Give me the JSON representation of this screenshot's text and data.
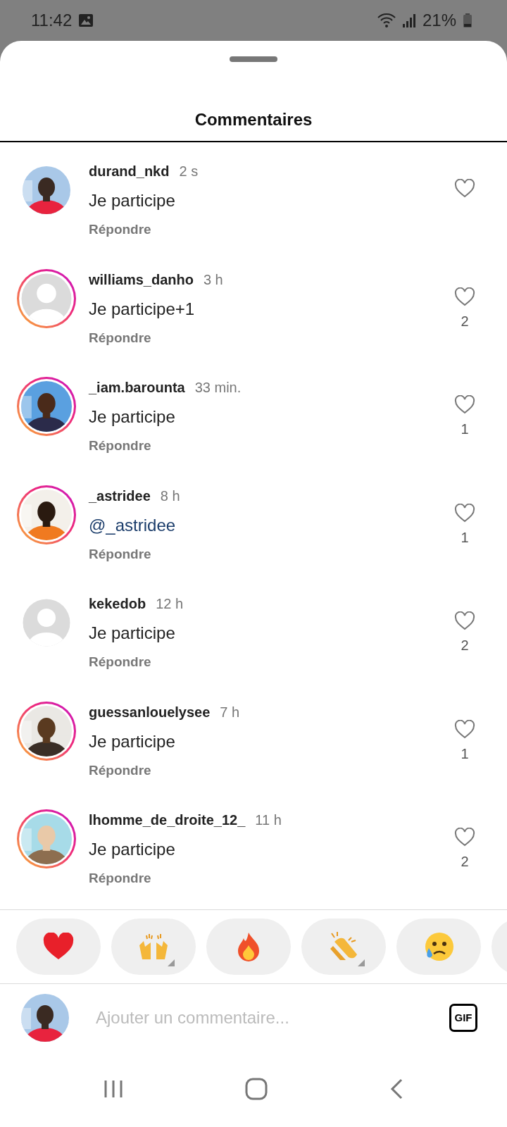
{
  "status_bar": {
    "time": "11:42",
    "battery": "21%"
  },
  "sheet": {
    "title": "Commentaires"
  },
  "comments": [
    {
      "username": "durand_nkd",
      "time": "2 s",
      "text": "Je participe",
      "mention": false,
      "reply": "Répondre",
      "avatar": {
        "kind": "picture",
        "story_ring": false
      }
    },
    {
      "username": "williams_danho",
      "time": "3 h",
      "text": "Je participe+1",
      "mention": false,
      "reply": "Répondre",
      "likes": "2",
      "avatar": {
        "kind": "default",
        "story_ring": true
      }
    },
    {
      "username": "_iam.barounta",
      "time": "33 min.",
      "text": "Je participe",
      "mention": false,
      "reply": "Répondre",
      "likes": "1",
      "avatar": {
        "kind": "picture",
        "story_ring": true
      }
    },
    {
      "username": "_astridee",
      "time": "8 h",
      "text": "@_astridee",
      "mention": true,
      "reply": "Répondre",
      "likes": "1",
      "avatar": {
        "kind": "picture",
        "story_ring": true
      }
    },
    {
      "username": "kekedob",
      "time": "12 h",
      "text": "Je participe",
      "mention": false,
      "reply": "Répondre",
      "likes": "2",
      "avatar": {
        "kind": "default",
        "story_ring": false
      }
    },
    {
      "username": "guessanlouelysee",
      "time": "7 h",
      "text": "Je participe",
      "mention": false,
      "reply": "Répondre",
      "likes": "1",
      "avatar": {
        "kind": "picture",
        "story_ring": true
      }
    },
    {
      "username": "lhomme_de_droite_12_",
      "time": "11 h",
      "text": "Je participe",
      "mention": false,
      "reply": "Répondre",
      "likes": "2",
      "avatar": {
        "kind": "picture",
        "story_ring": true
      }
    }
  ],
  "reactions": [
    {
      "kind": "heart",
      "variants": false
    },
    {
      "kind": "raised-hands",
      "variants": true
    },
    {
      "kind": "fire",
      "variants": false
    },
    {
      "kind": "clap",
      "variants": true
    },
    {
      "kind": "crying-face",
      "variants": false
    },
    {
      "kind": "partial"
    }
  ],
  "composer": {
    "avatar": {
      "kind": "picture"
    },
    "placeholder": "Ajouter un commentaire...",
    "gif": "GIF"
  }
}
